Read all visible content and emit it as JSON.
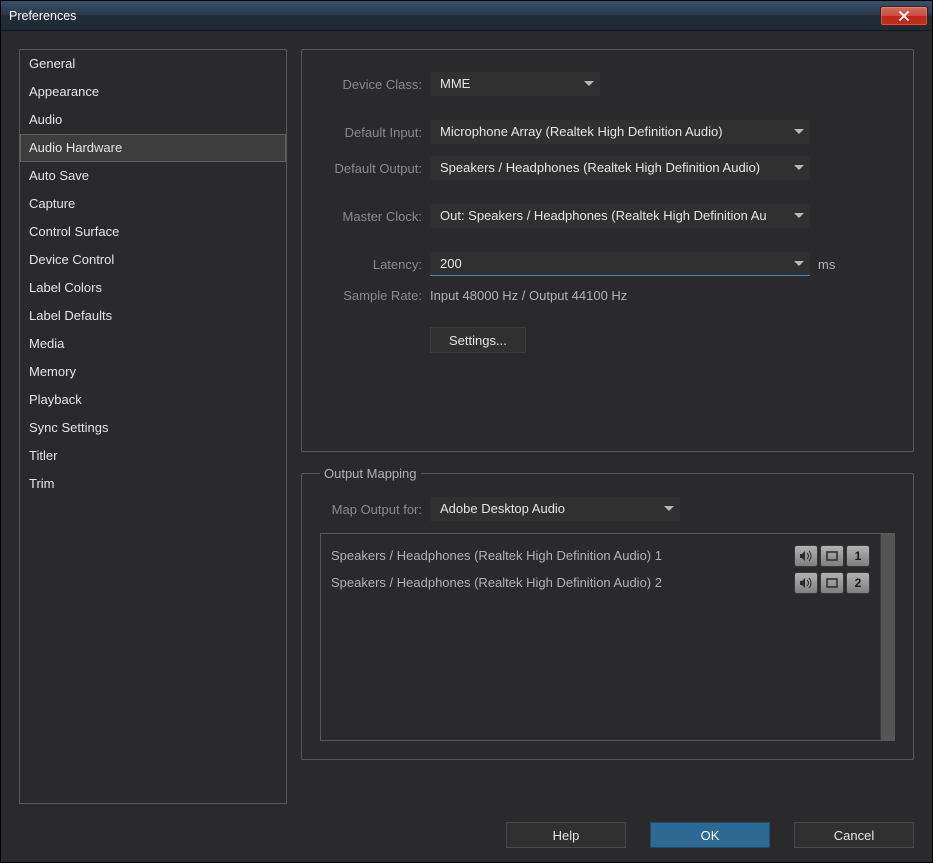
{
  "window": {
    "title": "Preferences"
  },
  "sidebar": {
    "items": [
      "General",
      "Appearance",
      "Audio",
      "Audio Hardware",
      "Auto Save",
      "Capture",
      "Control Surface",
      "Device Control",
      "Label Colors",
      "Label Defaults",
      "Media",
      "Memory",
      "Playback",
      "Sync Settings",
      "Titler",
      "Trim"
    ],
    "selected_index": 3
  },
  "labels": {
    "device_class": "Device Class:",
    "default_input": "Default Input:",
    "default_output": "Default Output:",
    "master_clock": "Master Clock:",
    "latency": "Latency:",
    "sample_rate": "Sample Rate:",
    "settings_btn": "Settings...",
    "output_mapping": "Output Mapping",
    "map_output_for": "Map Output for:",
    "latency_suffix": "ms"
  },
  "values": {
    "device_class": "MME",
    "default_input": "Microphone Array (Realtek High Definition Audio)",
    "default_output": "Speakers / Headphones (Realtek High Definition Audio)",
    "master_clock": "Out: Speakers / Headphones (Realtek High Definition Au",
    "latency": "200",
    "sample_rate": "Input 48000 Hz / Output 44100 Hz",
    "map_output_for": "Adobe Desktop Audio"
  },
  "output_mapping": {
    "rows": [
      {
        "label": "Speakers / Headphones (Realtek High Definition Audio) 1",
        "num": "1"
      },
      {
        "label": "Speakers / Headphones (Realtek High Definition Audio) 2",
        "num": "2"
      }
    ]
  },
  "footer": {
    "help": "Help",
    "ok": "OK",
    "cancel": "Cancel"
  }
}
